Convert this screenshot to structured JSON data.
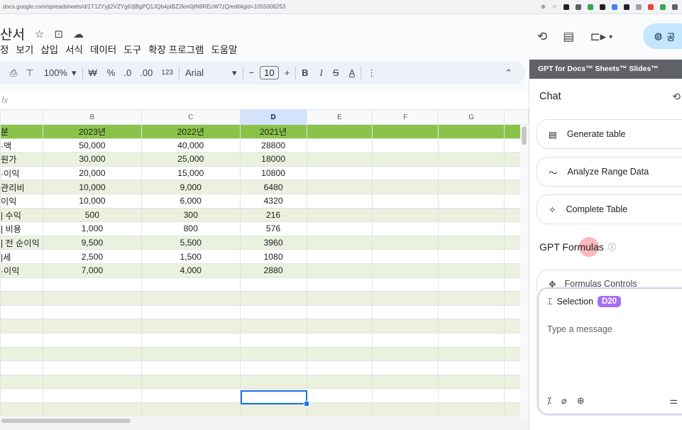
{
  "browser": {
    "url": "docs.google.com/spreadsheets/d/1T12Yyjt2VZYg63jBgPQ1JQb4piBZ2km0jtN9REcW7zQ/edit#gid=1055008253",
    "zoom_icon": "zoom-icon",
    "star_icon": "star-icon"
  },
  "doc": {
    "title": "산서",
    "menu": [
      "정",
      "보기",
      "삽입",
      "서식",
      "데이터",
      "도구",
      "확장 프로그램",
      "도움말"
    ]
  },
  "toolbar": {
    "zoom": "100%",
    "currency": "₩",
    "percent": "%",
    "dec_decrease": ".0",
    "dec_increase": ".00",
    "number_fmt": "123",
    "font": "Arial",
    "font_size": "10",
    "minus": "−",
    "plus": "+",
    "bold": "B",
    "italic": "I",
    "strike": "S",
    "text_color": "A",
    "more": "⋮"
  },
  "formula_bar": {
    "label": "fx"
  },
  "columns": [
    "",
    "B",
    "C",
    "D",
    "E",
    "F",
    "G"
  ],
  "rows": [
    {
      "label": "분",
      "b": "2023년",
      "c": "2022년",
      "d": "2021년",
      "style": "green"
    },
    {
      "label": "·액",
      "b": "50,000",
      "c": "40,000",
      "d": "28800",
      "style": "plain"
    },
    {
      "label": "원가",
      "b": "30,000",
      "c": "25,000",
      "d": "18000",
      "style": "band"
    },
    {
      "label": "·이익",
      "b": "20,000",
      "c": "15,000",
      "d": "10800",
      "style": "plain"
    },
    {
      "label": "관리비",
      "b": "10,000",
      "c": "9,000",
      "d": "6480",
      "style": "band"
    },
    {
      "label": "이익",
      "b": "10,000",
      "c": "6,000",
      "d": "4320",
      "style": "plain"
    },
    {
      "label": "| 수익",
      "b": "500",
      "c": "300",
      "d": "216",
      "style": "band"
    },
    {
      "label": "| 비용",
      "b": "1,000",
      "c": "800",
      "d": "576",
      "style": "plain"
    },
    {
      "label": "| 전 순이익",
      "b": "9,500",
      "c": "5,500",
      "d": "3960",
      "style": "band"
    },
    {
      "label": "|세",
      "b": "2,500",
      "c": "1,500",
      "d": "1080",
      "style": "plain"
    },
    {
      "label": "·이익",
      "b": "7,000",
      "c": "4,000",
      "d": "2880",
      "style": "band"
    }
  ],
  "empty_rows": 10,
  "right_top": {
    "share_label": "공"
  },
  "sidebar": {
    "header": "GPT for Docs™ Sheets™ Slides™",
    "chat_title": "Chat",
    "actions": [
      "Generate table",
      "Analyze Range Data",
      "Complete Table"
    ],
    "formulas_title": "GPT Formulas",
    "formulas_controls": "Formulas Controls",
    "selection_label": "Selection",
    "selection_chip": "D20",
    "input_placeholder": "Type a message"
  },
  "colors": {
    "header_green": "#8bc34a",
    "band": "#ebf1de",
    "selection": "#1a73e8",
    "chip": "#a56ef5"
  }
}
